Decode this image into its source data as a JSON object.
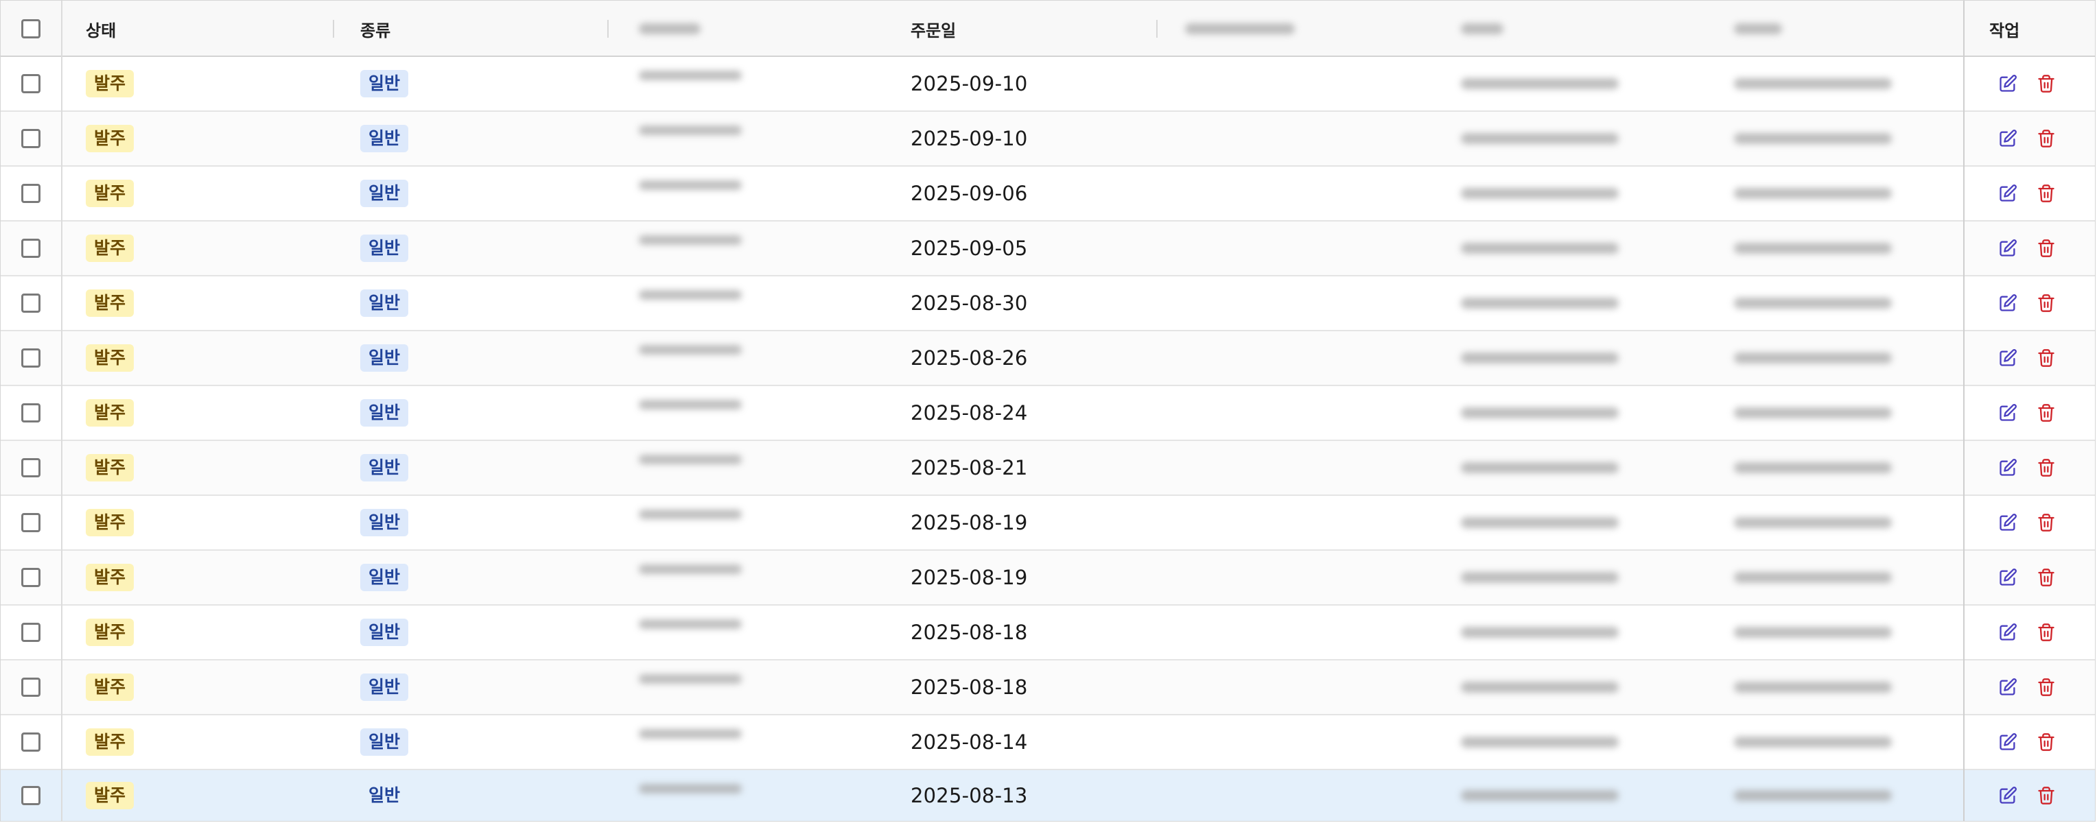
{
  "columns": {
    "status": "상태",
    "kind": "종류",
    "order_date": "주문일",
    "actions": "작업"
  },
  "colors": {
    "status_badge_bg": "#fdf3b8",
    "kind_badge_bg": "#dde9fb",
    "selected_row_bg": "#e4f0fb",
    "edit_icon": "#4a3fc0",
    "delete_icon": "#d0252b"
  },
  "icons": {
    "edit": "edit-icon",
    "delete": "trash-icon"
  },
  "rows": [
    {
      "status": "발주",
      "kind": "일반",
      "order_date": "2025-09-10",
      "selected": false
    },
    {
      "status": "발주",
      "kind": "일반",
      "order_date": "2025-09-10",
      "selected": false
    },
    {
      "status": "발주",
      "kind": "일반",
      "order_date": "2025-09-06",
      "selected": false
    },
    {
      "status": "발주",
      "kind": "일반",
      "order_date": "2025-09-05",
      "selected": false
    },
    {
      "status": "발주",
      "kind": "일반",
      "order_date": "2025-08-30",
      "selected": false
    },
    {
      "status": "발주",
      "kind": "일반",
      "order_date": "2025-08-26",
      "selected": false
    },
    {
      "status": "발주",
      "kind": "일반",
      "order_date": "2025-08-24",
      "selected": false
    },
    {
      "status": "발주",
      "kind": "일반",
      "order_date": "2025-08-21",
      "selected": false
    },
    {
      "status": "발주",
      "kind": "일반",
      "order_date": "2025-08-19",
      "selected": false
    },
    {
      "status": "발주",
      "kind": "일반",
      "order_date": "2025-08-19",
      "selected": false
    },
    {
      "status": "발주",
      "kind": "일반",
      "order_date": "2025-08-18",
      "selected": false
    },
    {
      "status": "발주",
      "kind": "일반",
      "order_date": "2025-08-18",
      "selected": false
    },
    {
      "status": "발주",
      "kind": "일반",
      "order_date": "2025-08-14",
      "selected": false
    },
    {
      "status": "발주",
      "kind": "일반",
      "order_date": "2025-08-13",
      "selected": true
    }
  ]
}
